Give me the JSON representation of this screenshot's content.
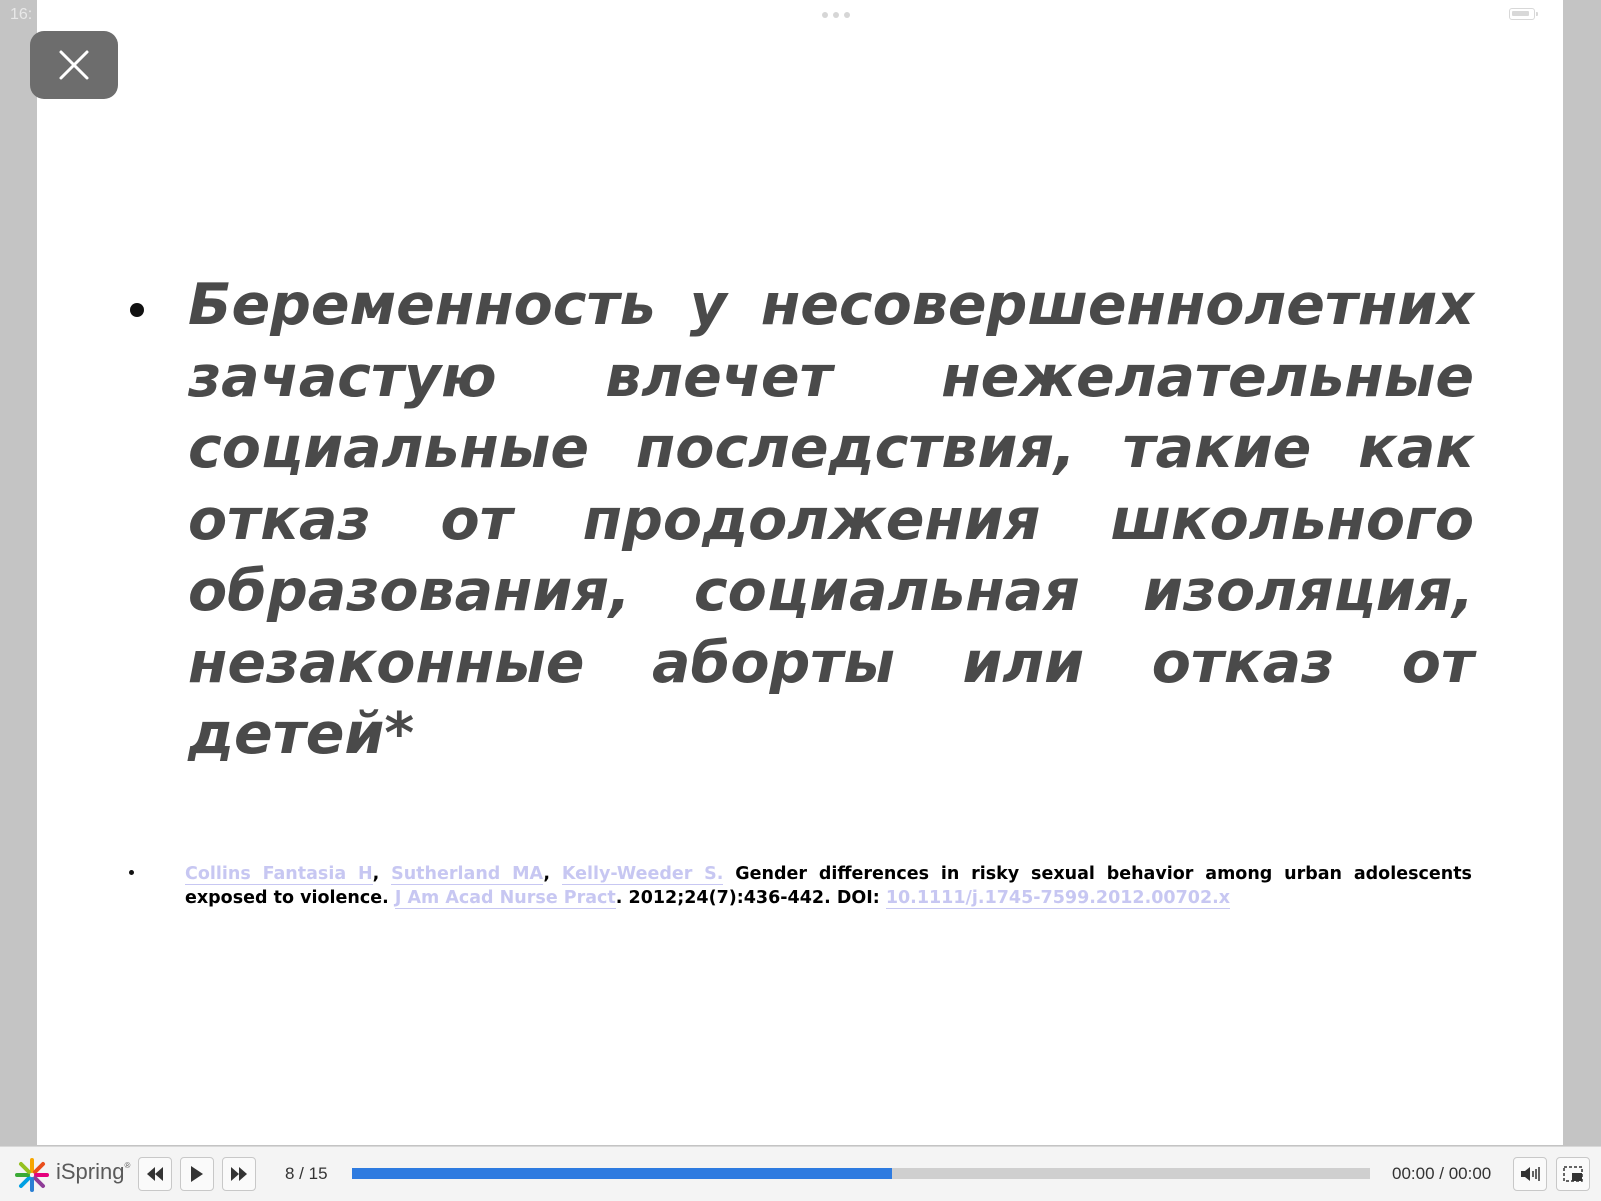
{
  "status_bar": {
    "time": "16:"
  },
  "slide": {
    "main_text": "Беременность у несовершеннолетних зачастую влечет нежелательные социальные последствия, такие как отказ от продолжения школьного образования, социальная изоляция, незаконные аборты или отказ от детей*",
    "reference": {
      "author1": "Collins Fantasia H",
      "sep1": ", ",
      "author2": "Sutherland MA",
      "sep2": ", ",
      "author3": "Kelly-Weeder S.",
      "title": " Gender differences in risky sexual behavior among urban adolescents exposed to violence. ",
      "journal": "J Am Acad Nurse Pract",
      "details": ". 2012;24(7):436-442. DOI: ",
      "doi": "10.1111/j.1745-7599.2012.00702.x"
    }
  },
  "player": {
    "brand": "iSpring",
    "brand_mark": "®",
    "slide_counter": "8 / 15",
    "progress": 0.53,
    "time": "00:00 / 00:00",
    "progress_color": "#2e7be0",
    "icons": [
      "close-icon",
      "rewind-icon",
      "play-icon",
      "fast-forward-icon",
      "volume-icon",
      "fullscreen-icon"
    ]
  }
}
